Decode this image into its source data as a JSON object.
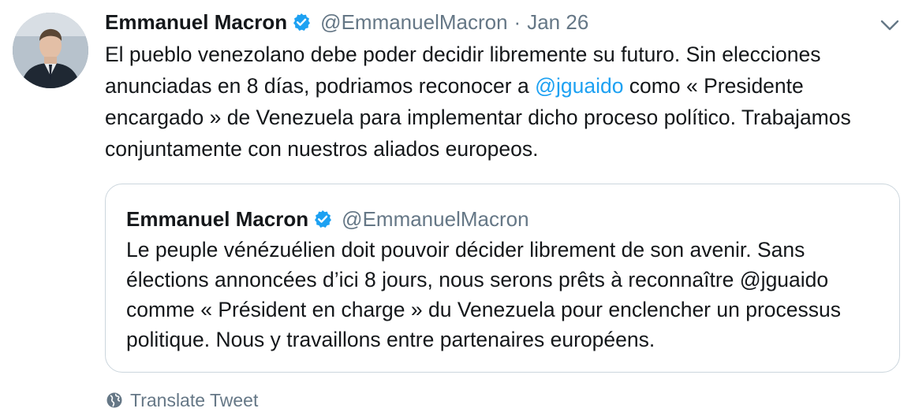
{
  "tweet": {
    "author_name": "Emmanuel Macron",
    "author_handle": "@EmmanuelMacron",
    "separator": "·",
    "date": "Jan 26",
    "text_before_mention": "El pueblo venezolano debe poder decidir libremente su futuro. Sin elecciones anunciadas en 8 días, podriamos reconocer a ",
    "mention": "@jguaido",
    "text_after_mention": " como « Presidente encargado » de Venezuela para implementar dicho proceso político. Trabajamos conjuntamente con nuestros aliados europeos.",
    "avatar_icon": "profile-photo",
    "verified_icon": "verified-badge-icon",
    "menu_icon": "chevron-down-icon"
  },
  "quoted_tweet": {
    "author_name": "Emmanuel Macron",
    "author_handle": "@EmmanuelMacron",
    "text": "Le peuple vénézuélien doit pouvoir décider librement de son avenir. Sans élections annoncées d’ici 8 jours, nous serons prêts à reconnaître @jguaido comme « Président en charge » du Venezuela pour enclencher un processus politique. Nous y travaillons entre partenaires européens."
  },
  "translate": {
    "label": "Translate Tweet",
    "icon": "globe-icon"
  },
  "colors": {
    "text": "#14171a",
    "secondary": "#657786",
    "link": "#1da1f2",
    "verified": "#1da1f2",
    "border": "#ccd6dd"
  }
}
